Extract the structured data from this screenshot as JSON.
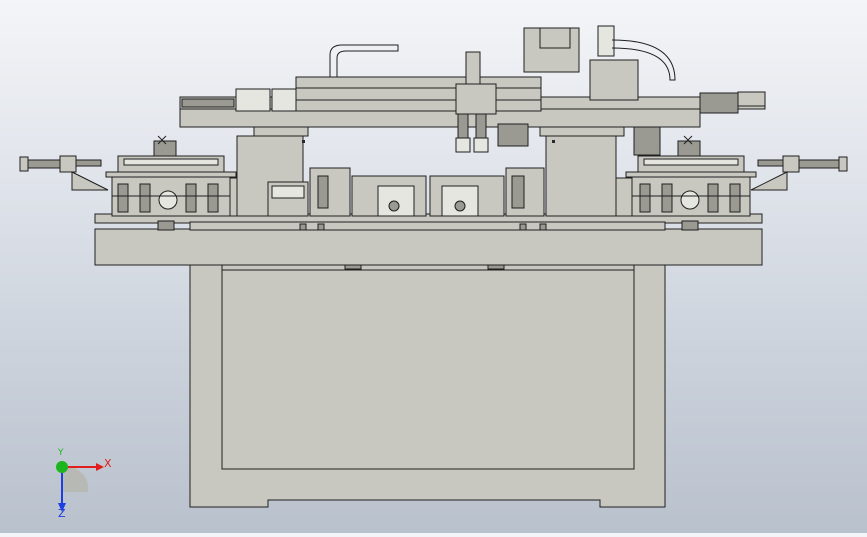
{
  "viewport": {
    "background_top": "#f4f5f8",
    "background_bottom": "#b9c1cd",
    "part_fill": "#c8c8c0",
    "part_stroke": "#1f1f1f"
  },
  "triad": {
    "x_label": "X",
    "y_label": "Y",
    "z_label": "Z",
    "x_color": "#e11d1d",
    "y_color": "#1db51d",
    "z_color": "#1d3fe1"
  }
}
